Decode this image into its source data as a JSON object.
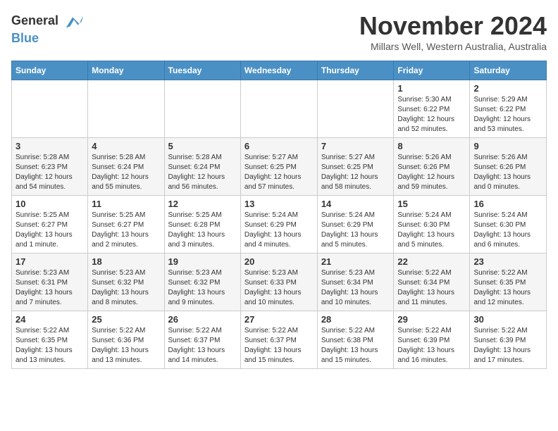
{
  "logo": {
    "line1": "General",
    "line2": "Blue"
  },
  "title": "November 2024",
  "subtitle": "Millars Well, Western Australia, Australia",
  "days_of_week": [
    "Sunday",
    "Monday",
    "Tuesday",
    "Wednesday",
    "Thursday",
    "Friday",
    "Saturday"
  ],
  "weeks": [
    [
      {
        "day": "",
        "info": ""
      },
      {
        "day": "",
        "info": ""
      },
      {
        "day": "",
        "info": ""
      },
      {
        "day": "",
        "info": ""
      },
      {
        "day": "",
        "info": ""
      },
      {
        "day": "1",
        "info": "Sunrise: 5:30 AM\nSunset: 6:22 PM\nDaylight: 12 hours\nand 52 minutes."
      },
      {
        "day": "2",
        "info": "Sunrise: 5:29 AM\nSunset: 6:22 PM\nDaylight: 12 hours\nand 53 minutes."
      }
    ],
    [
      {
        "day": "3",
        "info": "Sunrise: 5:28 AM\nSunset: 6:23 PM\nDaylight: 12 hours\nand 54 minutes."
      },
      {
        "day": "4",
        "info": "Sunrise: 5:28 AM\nSunset: 6:24 PM\nDaylight: 12 hours\nand 55 minutes."
      },
      {
        "day": "5",
        "info": "Sunrise: 5:28 AM\nSunset: 6:24 PM\nDaylight: 12 hours\nand 56 minutes."
      },
      {
        "day": "6",
        "info": "Sunrise: 5:27 AM\nSunset: 6:25 PM\nDaylight: 12 hours\nand 57 minutes."
      },
      {
        "day": "7",
        "info": "Sunrise: 5:27 AM\nSunset: 6:25 PM\nDaylight: 12 hours\nand 58 minutes."
      },
      {
        "day": "8",
        "info": "Sunrise: 5:26 AM\nSunset: 6:26 PM\nDaylight: 12 hours\nand 59 minutes."
      },
      {
        "day": "9",
        "info": "Sunrise: 5:26 AM\nSunset: 6:26 PM\nDaylight: 13 hours\nand 0 minutes."
      }
    ],
    [
      {
        "day": "10",
        "info": "Sunrise: 5:25 AM\nSunset: 6:27 PM\nDaylight: 13 hours\nand 1 minute."
      },
      {
        "day": "11",
        "info": "Sunrise: 5:25 AM\nSunset: 6:27 PM\nDaylight: 13 hours\nand 2 minutes."
      },
      {
        "day": "12",
        "info": "Sunrise: 5:25 AM\nSunset: 6:28 PM\nDaylight: 13 hours\nand 3 minutes."
      },
      {
        "day": "13",
        "info": "Sunrise: 5:24 AM\nSunset: 6:29 PM\nDaylight: 13 hours\nand 4 minutes."
      },
      {
        "day": "14",
        "info": "Sunrise: 5:24 AM\nSunset: 6:29 PM\nDaylight: 13 hours\nand 5 minutes."
      },
      {
        "day": "15",
        "info": "Sunrise: 5:24 AM\nSunset: 6:30 PM\nDaylight: 13 hours\nand 5 minutes."
      },
      {
        "day": "16",
        "info": "Sunrise: 5:24 AM\nSunset: 6:30 PM\nDaylight: 13 hours\nand 6 minutes."
      }
    ],
    [
      {
        "day": "17",
        "info": "Sunrise: 5:23 AM\nSunset: 6:31 PM\nDaylight: 13 hours\nand 7 minutes."
      },
      {
        "day": "18",
        "info": "Sunrise: 5:23 AM\nSunset: 6:32 PM\nDaylight: 13 hours\nand 8 minutes."
      },
      {
        "day": "19",
        "info": "Sunrise: 5:23 AM\nSunset: 6:32 PM\nDaylight: 13 hours\nand 9 minutes."
      },
      {
        "day": "20",
        "info": "Sunrise: 5:23 AM\nSunset: 6:33 PM\nDaylight: 13 hours\nand 10 minutes."
      },
      {
        "day": "21",
        "info": "Sunrise: 5:23 AM\nSunset: 6:34 PM\nDaylight: 13 hours\nand 10 minutes."
      },
      {
        "day": "22",
        "info": "Sunrise: 5:22 AM\nSunset: 6:34 PM\nDaylight: 13 hours\nand 11 minutes."
      },
      {
        "day": "23",
        "info": "Sunrise: 5:22 AM\nSunset: 6:35 PM\nDaylight: 13 hours\nand 12 minutes."
      }
    ],
    [
      {
        "day": "24",
        "info": "Sunrise: 5:22 AM\nSunset: 6:35 PM\nDaylight: 13 hours\nand 13 minutes."
      },
      {
        "day": "25",
        "info": "Sunrise: 5:22 AM\nSunset: 6:36 PM\nDaylight: 13 hours\nand 13 minutes."
      },
      {
        "day": "26",
        "info": "Sunrise: 5:22 AM\nSunset: 6:37 PM\nDaylight: 13 hours\nand 14 minutes."
      },
      {
        "day": "27",
        "info": "Sunrise: 5:22 AM\nSunset: 6:37 PM\nDaylight: 13 hours\nand 15 minutes."
      },
      {
        "day": "28",
        "info": "Sunrise: 5:22 AM\nSunset: 6:38 PM\nDaylight: 13 hours\nand 15 minutes."
      },
      {
        "day": "29",
        "info": "Sunrise: 5:22 AM\nSunset: 6:39 PM\nDaylight: 13 hours\nand 16 minutes."
      },
      {
        "day": "30",
        "info": "Sunrise: 5:22 AM\nSunset: 6:39 PM\nDaylight: 13 hours\nand 17 minutes."
      }
    ]
  ]
}
